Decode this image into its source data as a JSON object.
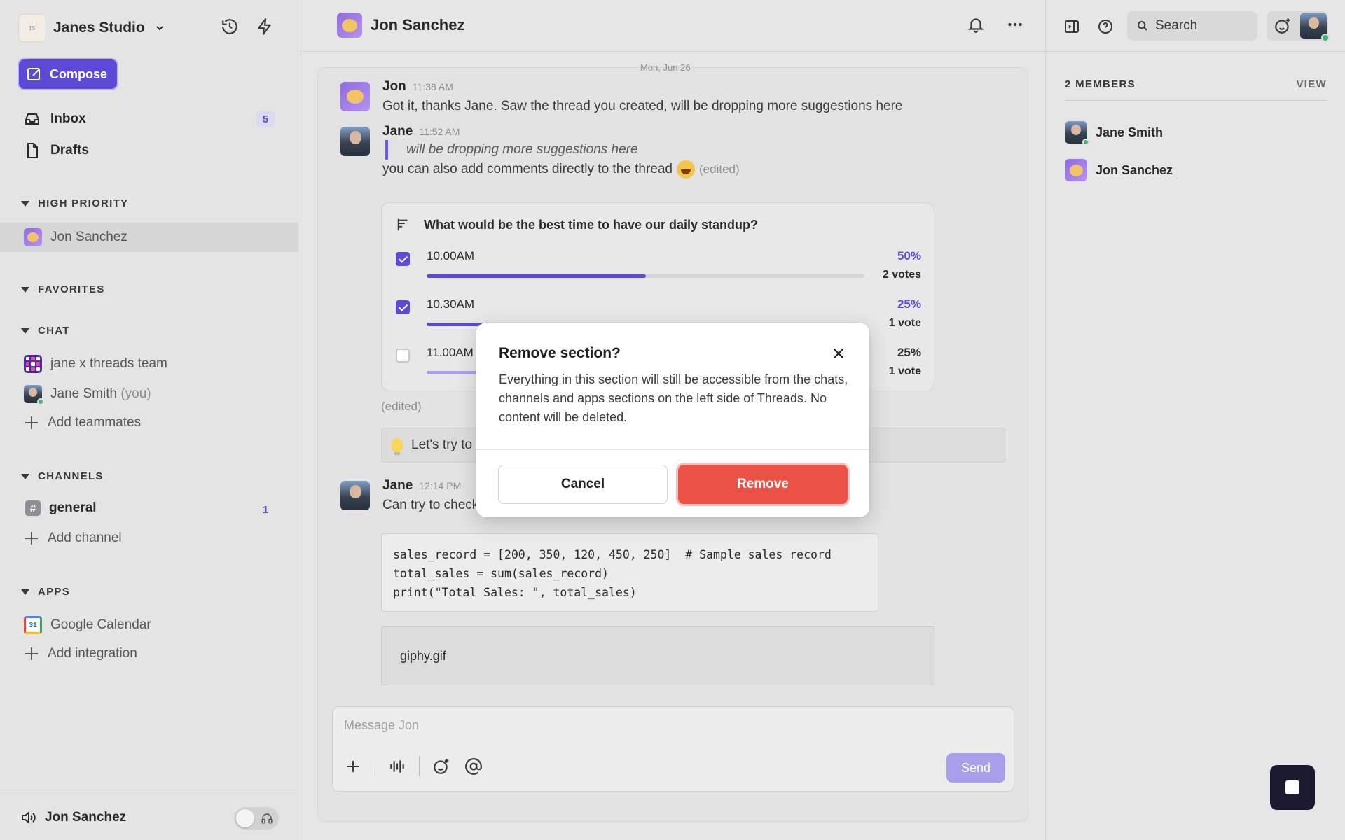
{
  "workspace": {
    "name": "Janes Studio",
    "logo_text": "JANES STUDIO"
  },
  "sidebar": {
    "compose_label": "Compose",
    "inbox": {
      "label": "Inbox",
      "count": "5"
    },
    "drafts": {
      "label": "Drafts"
    },
    "sections": {
      "high_priority": "HIGH PRIORITY",
      "favorites": "FAVORITES",
      "chat": "CHAT",
      "channels": "CHANNELS",
      "apps": "APPS"
    },
    "high_priority_items": [
      {
        "label": "Jon Sanchez"
      }
    ],
    "chat_items": [
      {
        "label": "jane x threads team"
      },
      {
        "label": "Jane Smith",
        "suffix": "(you)"
      }
    ],
    "add_teammates": "Add teammates",
    "channel_items": [
      {
        "label": "general",
        "count": "1"
      }
    ],
    "add_channel": "Add channel",
    "app_items": [
      {
        "label": "Google Calendar",
        "icon_text": "31"
      }
    ],
    "add_integration": "Add integration",
    "footer": {
      "label": "Jon Sanchez"
    }
  },
  "header": {
    "title": "Jon Sanchez"
  },
  "chat": {
    "date_chip": "Mon, Jun 26",
    "messages": [
      {
        "author": "Jon",
        "time": "11:38 AM",
        "text": "Got it, thanks Jane. Saw the thread you created, will be dropping more suggestions here"
      },
      {
        "author": "Jane",
        "time": "11:52 AM",
        "quote": "will be dropping more suggestions here",
        "text": "you can also add comments directly to the thread",
        "edited": "(edited)"
      },
      {
        "author": "Jane",
        "time": "12:14 PM",
        "text": "Can try to check"
      }
    ],
    "poll": {
      "question": "What would be the best time to have our daily standup?",
      "options": [
        {
          "label": "10.00AM",
          "percent": "50%",
          "votes": "2 votes",
          "fraction": 0.5,
          "checked": true
        },
        {
          "label": "10.30AM",
          "percent": "25%",
          "votes": "1 vote",
          "fraction": 0.25,
          "checked": true
        },
        {
          "label": "11.00AM",
          "percent": "25%",
          "votes": "1 vote",
          "fraction": 0.25,
          "checked": false
        }
      ],
      "edited": "(edited)"
    },
    "callout_text": "Let's try to",
    "code_lines": [
      "sales_record = [200, 350, 120, 450, 250]  # Sample sales record",
      "total_sales = sum(sales_record)",
      "print(\"Total Sales: \", total_sales)"
    ],
    "attachment": "giphy.gif",
    "composer": {
      "placeholder": "Message Jon",
      "send_label": "Send"
    }
  },
  "right_panel": {
    "search_label": "Search",
    "members_title": "2 MEMBERS",
    "view_label": "VIEW",
    "members": [
      {
        "name": "Jane Smith"
      },
      {
        "name": "Jon Sanchez"
      }
    ]
  },
  "modal": {
    "title": "Remove section?",
    "body": "Everything in this section will still be accessible from the chats, channels and apps sections on the left side of Threads. No content will be deleted.",
    "cancel_label": "Cancel",
    "confirm_label": "Remove"
  },
  "colors": {
    "accent": "#5b4ad6",
    "danger": "#ec5147",
    "online": "#3cb371"
  },
  "icons": [
    "chevron-down-icon",
    "history-icon",
    "lightning-icon",
    "compose-icon",
    "inbox-icon",
    "drafts-icon",
    "bell-icon",
    "more-icon",
    "panel-icon",
    "help-icon",
    "search-icon",
    "emoji-icon",
    "plus-icon",
    "waveform-icon",
    "mention-icon",
    "speaker-icon",
    "headphones-icon",
    "close-icon",
    "poll-icon",
    "stop-icon"
  ]
}
